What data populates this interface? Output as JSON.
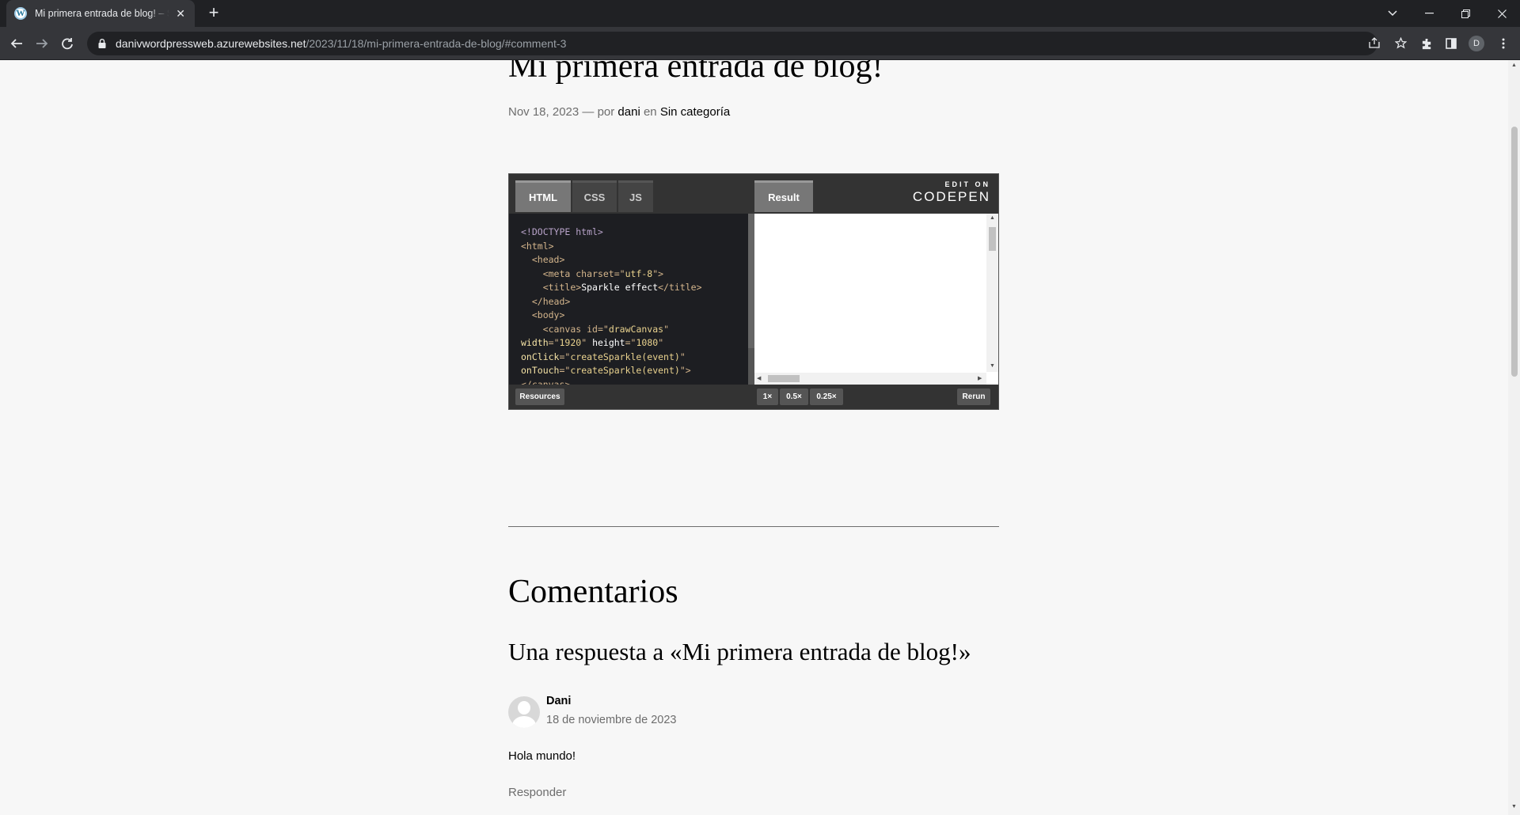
{
  "browser": {
    "tab_title": "Mi primera entrada de blog! – Si",
    "tab_favicon": "W",
    "tab_close": "✕",
    "new_tab": "+",
    "url_host": "danivwordpressweb.azurewebsites.net",
    "url_path": "/2023/11/18/mi-primera-entrada-de-blog/#comment-3",
    "profile_initial": "D",
    "icons": [
      "wordpress-icon",
      "back-icon",
      "forward-icon",
      "reload-icon",
      "lock-icon",
      "share-icon",
      "star-icon",
      "extensions-icon",
      "sidepanel-icon",
      "menu-icon",
      "minimize-icon",
      "maximize-icon",
      "close-icon"
    ]
  },
  "post": {
    "title": "Mi primera entrada de blog!",
    "date": "Nov 18, 2023",
    "separator": " — por ",
    "author": "dani",
    "in_word": " en ",
    "category": "Sin categoría"
  },
  "codepen": {
    "tabs": [
      "HTML",
      "CSS",
      "JS"
    ],
    "result_tab": "Result",
    "brand_top": "EDIT ON",
    "brand": "CODEPEN",
    "resources": "Resources",
    "zoom": [
      "1×",
      "0.5×",
      "0.25×"
    ],
    "rerun": "Rerun",
    "code_lines": [
      "<!DOCTYPE html>",
      "<html>",
      "  <head>",
      "    <meta charset=\"utf-8\">",
      "    <title>Sparkle effect</title>",
      "  </head>",
      "  <body>",
      "    <canvas id=\"drawCanvas\"",
      "width=\"1920\" height=\"1080\"",
      "onClick=\"createSparkle(event)\"",
      "onTouch=\"createSparkle(event)\">",
      "</canvas>"
    ]
  },
  "comments": {
    "title": "Comentarios",
    "reply_title": "Una respuesta a «Mi primera entrada de blog!»",
    "items": [
      {
        "author": "Dani",
        "date": "18 de noviembre de 2023",
        "text": "Hola mundo!",
        "reply": "Responder"
      }
    ]
  }
}
